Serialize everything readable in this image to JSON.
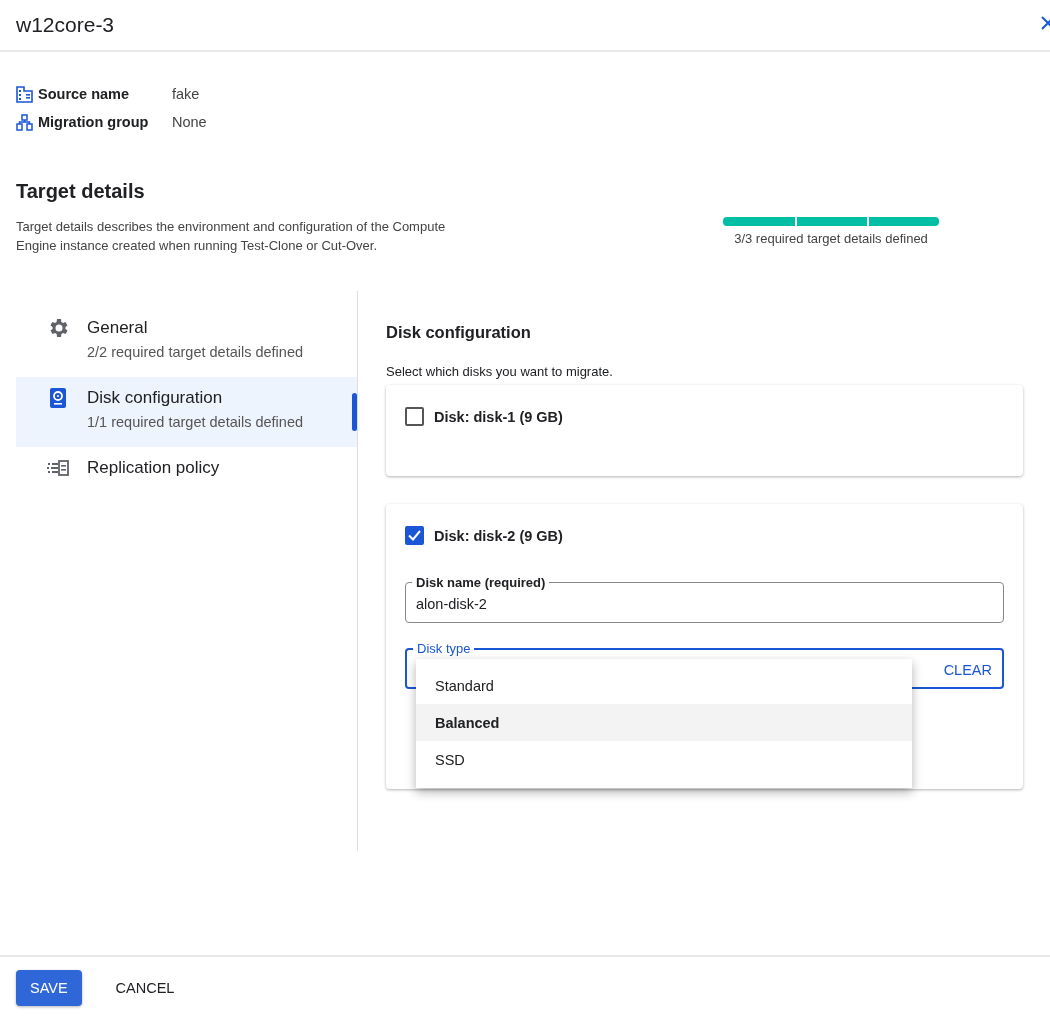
{
  "window": {
    "title": "w12core-3"
  },
  "info": [
    {
      "label": "Source name",
      "value": "fake"
    },
    {
      "label": "Migration group",
      "value": "None"
    }
  ],
  "target": {
    "title": "Target details",
    "description": "Target details describes the environment and configuration of the Compute Engine instance created when running Test-Clone or Cut-Over.",
    "progress": {
      "level": 1,
      "label": "3/3 required target details defined"
    }
  },
  "sidebar": {
    "items": [
      {
        "label": "General",
        "subtitle": "2/2 required target details defined",
        "selected": false
      },
      {
        "label": "Disk configuration",
        "subtitle": "1/1 required target details defined",
        "selected": true
      },
      {
        "label": "Replication policy",
        "selected": false
      }
    ]
  },
  "disk_config": {
    "title": "Disk configuration",
    "hint": "Select which disks you want to migrate.",
    "disks": [
      {
        "label": "Disk: disk-1 (9 GB)",
        "checked": false
      },
      {
        "label": "Disk: disk-2 (9 GB)",
        "checked": true,
        "name_field": {
          "label": "Disk name (required)",
          "value": "alon-disk-2"
        },
        "type_field": {
          "label": "Disk type",
          "clear": "CLEAR",
          "options": [
            {
              "label": "Standard",
              "selected": false
            },
            {
              "label": "Balanced",
              "selected": true
            },
            {
              "label": "SSD",
              "selected": false
            }
          ]
        }
      }
    ]
  },
  "footer": {
    "save": "SAVE",
    "cancel": "CANCEL"
  }
}
